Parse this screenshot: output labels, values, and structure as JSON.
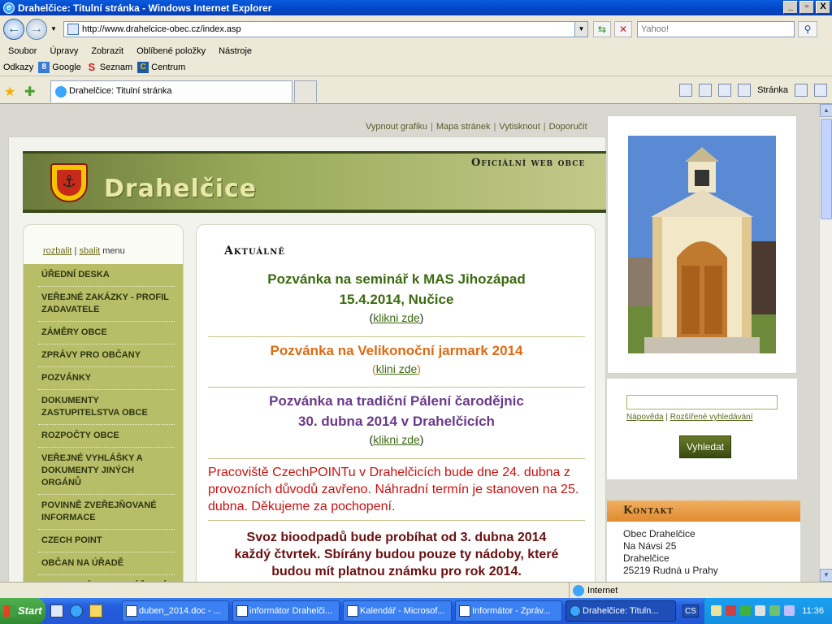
{
  "window": {
    "title": "Drahelčice: Titulní stránka - Windows Internet Explorer",
    "controls": [
      "_",
      "▫",
      "X"
    ]
  },
  "address_bar": {
    "url": "http://www.drahelcice-obec.cz/index.asp",
    "search_placeholder": "Yahoo!"
  },
  "menubar": [
    "Soubor",
    "Úpravy",
    "Zobrazit",
    "Oblíbené položky",
    "Nástroje"
  ],
  "links_bar": {
    "label": "Odkazy",
    "items": [
      "Google",
      "Seznam",
      "Centrum"
    ]
  },
  "tabs": {
    "active": "Drahelčice: Titulní stránka"
  },
  "command_bar": {
    "page_label": "Stránka"
  },
  "site": {
    "top_nav": [
      "Vypnout grafiku",
      "Mapa stránek",
      "Vytisknout",
      "Doporučit"
    ],
    "name": "Drahelčice",
    "tagline": "Oficiální web obce",
    "menu_toggle": {
      "expand": "rozbalit",
      "collapse": "sbalit",
      "suffix": "menu"
    },
    "menu": [
      "ÚŘEDNÍ DESKA",
      "VEŘEJNÉ ZAKÁZKY - PROFIL ZADAVATELE",
      "ZÁMĚRY OBCE",
      "ZPRÁVY PRO OBČANY",
      "POZVÁNKY",
      "DOKUMENTY ZASTUPITELSTVA OBCE",
      "ROZPOČTY OBCE",
      "VEŘEJNÉ VYHLÁŠKY A DOKUMENTY JINÝCH ORGÁNŮ",
      "POVINNĚ ZVEŘEJŇOVANÉ INFORMACE",
      "CZECH POINT",
      "OBČAN NA ÚŘADĚ",
      "ODPADOVÉ HOSPODÁŘSTVÍ"
    ],
    "news_heading": "Aktuálně",
    "news": {
      "n1": {
        "title_line1": "Pozvánka na seminář k MAS Jihozápad",
        "title_line2": "15.4.2014, Nučice",
        "link": "klikni zde"
      },
      "n2": {
        "title": "Pozvánka na Velikonoční jarmark 2014",
        "link": "klini zde"
      },
      "n3": {
        "title_line1": "Pozvánka na tradiční Pálení čarodějnic",
        "title_line2": "30. dubna 2014 v Drahelčicích",
        "link": "klikni zde"
      },
      "n4": {
        "body": "Pracoviště CzechPOINTu v Drahelčicích bude dne 24. dubna z provozních důvodů zavřeno. Náhradní termín je stanoven na 25. dubna. Děkujeme za pochopení."
      },
      "n5": {
        "line1": "Svoz bioodpadů bude probíhat od 3. dubna 2014",
        "line2": "každý čtvrtek. Sbírány budou pouze ty nádoby, které",
        "line3": "budou mít platnou známku pro rok 2014."
      }
    },
    "search": {
      "help": "Nápověda",
      "advanced": "Rozšířené vyhledávání",
      "button": "Vyhledat"
    },
    "contact": {
      "heading": "Kontakt",
      "lines": [
        "Obec Drahelčice",
        "Na Návsi 25",
        "Drahelčice",
        "25219 Rudná u Prahy"
      ]
    }
  },
  "status_bar": {
    "zone": "Internet"
  },
  "taskbar": {
    "start": "Start",
    "buttons": [
      "duben_2014.doc - ...",
      "informátor Drahelči...",
      "Kalendář - Microsof...",
      "Informátor - Zpráv...",
      "Drahelčice: Tituln..."
    ],
    "language": "CS",
    "clock": "11:36"
  },
  "colors": {
    "menu_bg": "#b8bd68",
    "banner_dark": "#3b4a1a",
    "accent_orange": "#e08a30",
    "news_green": "#3b6b10",
    "news_orange": "#e06a10",
    "news_purple": "#6a3a8a",
    "alert_red": "#cc1010"
  }
}
